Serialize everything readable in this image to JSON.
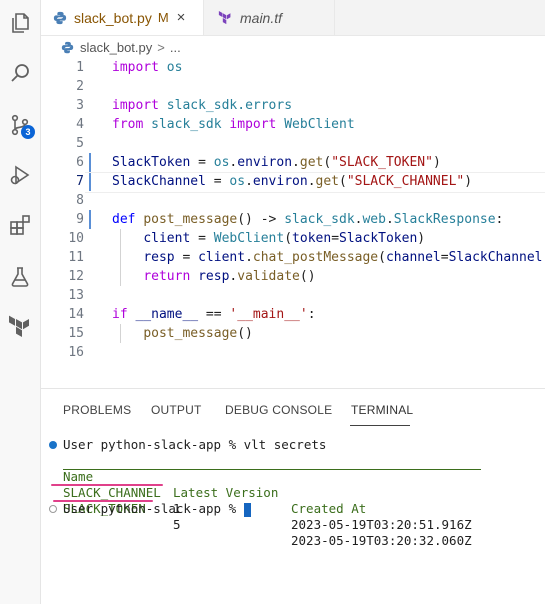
{
  "activity_bar": {
    "items": [
      {
        "name": "explorer-icon"
      },
      {
        "name": "search-icon"
      },
      {
        "name": "source-control-icon",
        "badge": "3"
      },
      {
        "name": "run-debug-icon"
      },
      {
        "name": "extensions-icon"
      },
      {
        "name": "testing-icon"
      },
      {
        "name": "terraform-icon"
      }
    ],
    "badge_color": "#0a64d6"
  },
  "tabs": [
    {
      "label": "slack_bot.py",
      "modified": "M",
      "close": "×",
      "active": true,
      "icon": "python-icon"
    },
    {
      "label": "main.tf",
      "active": false,
      "icon": "terraform-icon"
    }
  ],
  "breadcrumb": {
    "file": "slack_bot.py",
    "separator": ">",
    "rest": "..."
  },
  "editor": {
    "line_numbers": [
      "1",
      "2",
      "3",
      "4",
      "5",
      "6",
      "7",
      "8",
      "9",
      "10",
      "11",
      "12",
      "13",
      "14",
      "15",
      "16"
    ],
    "current_line": 7
  },
  "panel": {
    "tabs": [
      "PROBLEMS",
      "OUTPUT",
      "DEBUG CONSOLE",
      "TERMINAL"
    ],
    "active_tab": "TERMINAL",
    "terminal": {
      "prompt1": "User python-slack-app % vlt secrets",
      "headers": {
        "name": "Name",
        "version": "Latest Version",
        "created": "Created At"
      },
      "rows": [
        {
          "name": "SLACK_CHANNEL",
          "version": "1",
          "created": "2023-05-19T03:20:51.916Z"
        },
        {
          "name": "SLACK_TOKEN",
          "version": "5",
          "created": "2023-05-19T03:20:32.060Z"
        }
      ],
      "prompt2": "User python-slack-app %"
    }
  }
}
